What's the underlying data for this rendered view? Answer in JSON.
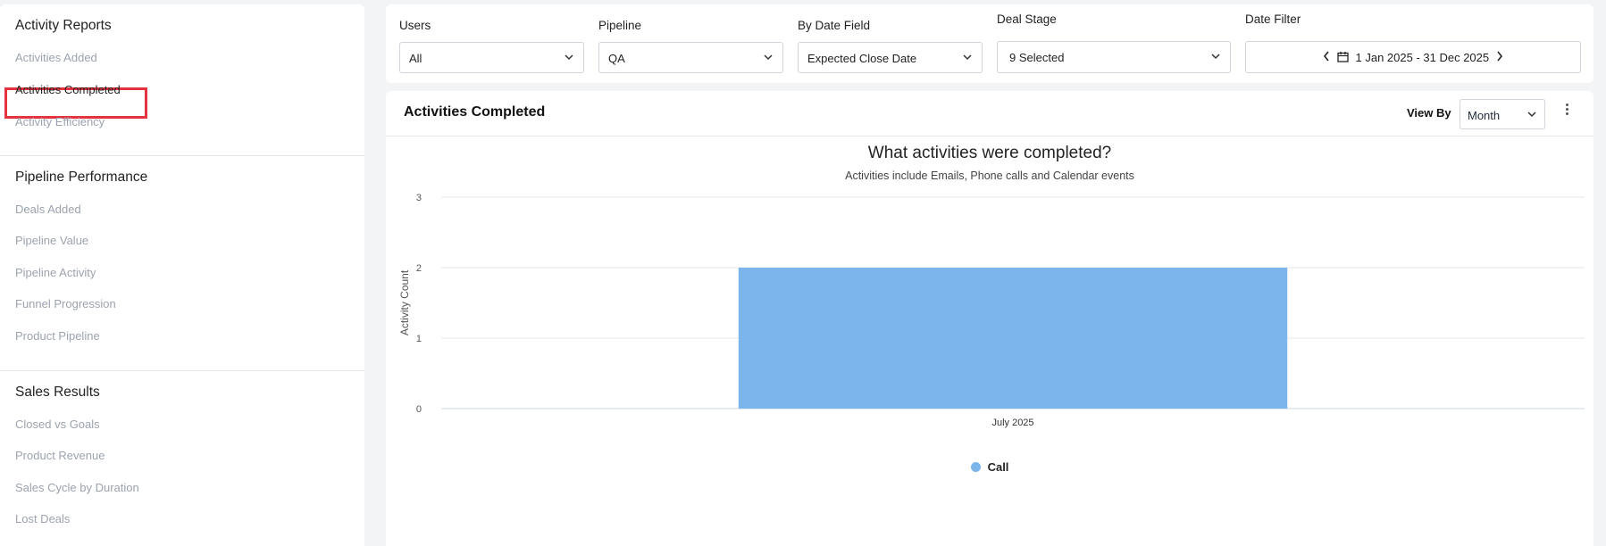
{
  "sidebar": {
    "sections": [
      {
        "title": "Activity Reports",
        "items": [
          "Activities Added",
          "Activities Completed",
          "Activity Efficiency"
        ]
      },
      {
        "title": "Pipeline Performance",
        "items": [
          "Deals Added",
          "Pipeline Value",
          "Pipeline Activity",
          "Funnel Progression",
          "Product Pipeline"
        ]
      },
      {
        "title": "Sales Results",
        "items": [
          "Closed vs Goals",
          "Product Revenue",
          "Sales Cycle by Duration",
          "Lost Deals"
        ]
      }
    ],
    "active_item": "Activities Completed"
  },
  "filters": {
    "users": {
      "label": "Users",
      "value": "All"
    },
    "pipeline": {
      "label": "Pipeline",
      "value": "QA"
    },
    "date_field": {
      "label": "By Date Field",
      "value": "Expected Close Date"
    },
    "deal_stage": {
      "label": "Deal Stage",
      "value": "9 Selected"
    },
    "date_filter": {
      "label": "Date Filter",
      "value": "1 Jan 2025 - 31 Dec 2025"
    }
  },
  "report": {
    "title": "Activities Completed",
    "view_by_label": "View By",
    "view_by_value": "Month"
  },
  "chart_data": {
    "type": "bar",
    "title": "What activities were completed?",
    "subtitle": "Activities include Emails, Phone calls and Calendar events",
    "categories": [
      "July 2025"
    ],
    "series": [
      {
        "name": "Call",
        "values": [
          2
        ]
      }
    ],
    "ylabel": "Activity Count",
    "xlabel": "",
    "ylim": [
      0,
      3
    ],
    "yticks": [
      0,
      1,
      2,
      3
    ],
    "grid": true,
    "legend": "bottom-center",
    "colors": {
      "Call": "#7cb5ec"
    }
  }
}
